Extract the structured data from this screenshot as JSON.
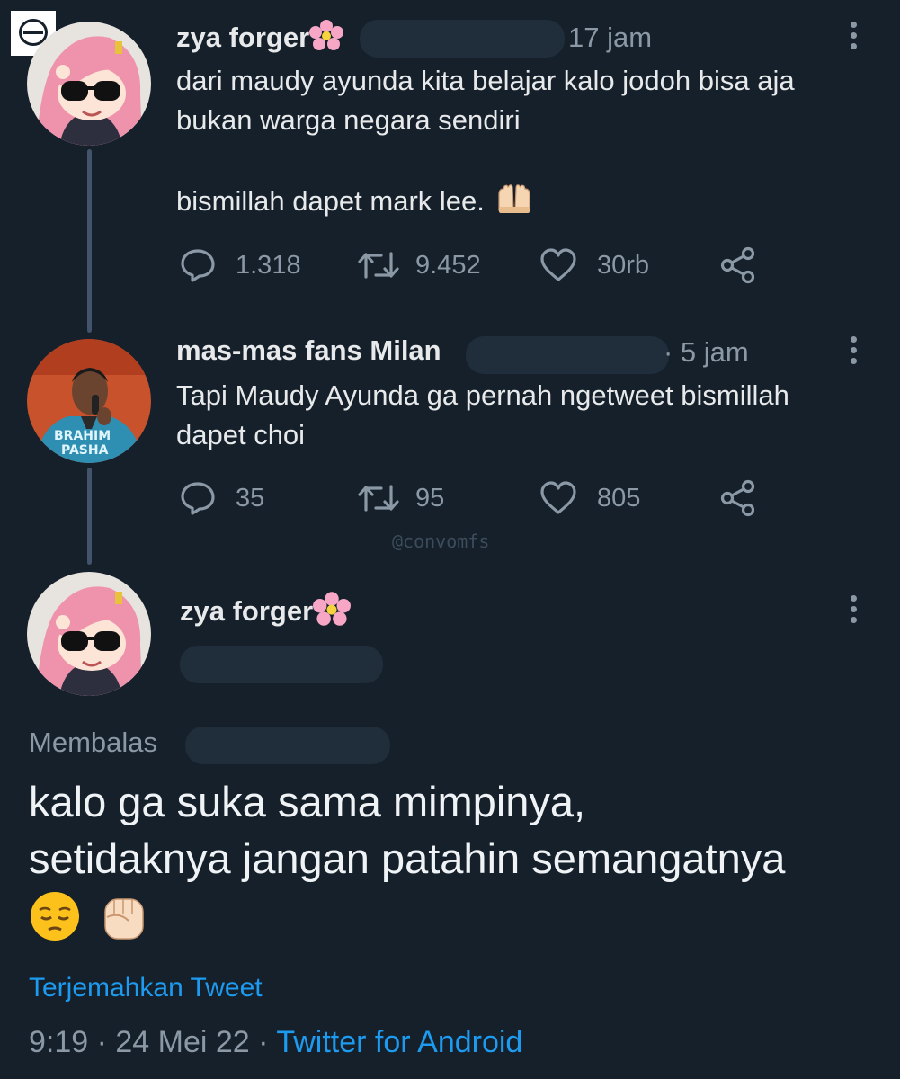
{
  "tweet1": {
    "name": "zya forger",
    "time": "17 jam",
    "line1": "dari maudy ayunda kita belajar kalo jodoh bisa aja",
    "line2": "bukan warga negara sendiri",
    "line3": "bismillah dapet mark lee.",
    "replies": "1.318",
    "retweets": "9.452",
    "likes": "30rb"
  },
  "tweet2": {
    "name": "mas-mas fans Milan",
    "time": "· 5 jam",
    "line1": "Tapi Maudy Ayunda ga pernah ngetweet bismillah",
    "line2": "dapet choi",
    "replies": "35",
    "retweets": "95",
    "likes": "805",
    "avatar_shirt_text": "BRAHIM\nPASHA"
  },
  "watermark": "@convomfs",
  "main_tweet": {
    "name": "zya forger",
    "replying_label": "Membalas",
    "line1": "kalo ga suka sama mimpinya,",
    "line2": "setidaknya jangan patahin semangatnya",
    "translate": "Terjemahkan Tweet",
    "timestamp": "9:19 · 24 Mei 22 ·",
    "source": "Twitter for Android"
  },
  "icons": [
    "reply-icon",
    "retweet-icon",
    "like-icon",
    "share-icon",
    "more-icon",
    "flower-emoji",
    "raised-hands-emoji",
    "pensive-emoji",
    "fist-emoji"
  ],
  "colors": {
    "background": "#15202b",
    "muted": "#8b98a5",
    "link": "#1d9bf0",
    "thread_line": "#42536b"
  }
}
